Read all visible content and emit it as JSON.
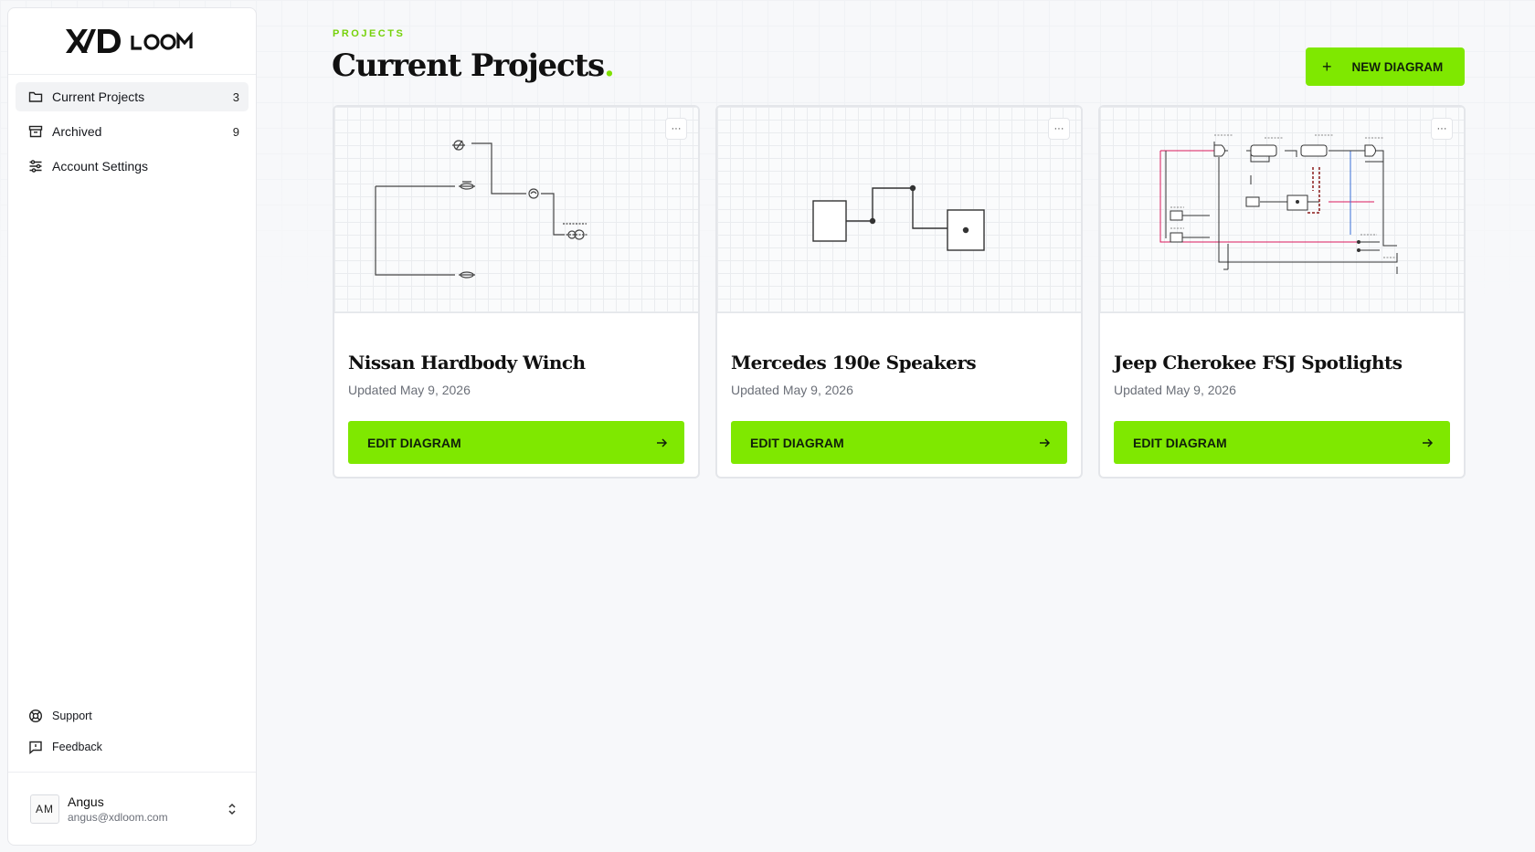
{
  "brand": {
    "logo_text": "X/D LOOM"
  },
  "sidebar": {
    "items": [
      {
        "label": "Current Projects",
        "count": "3",
        "icon": "folder-icon"
      },
      {
        "label": "Archived",
        "count": "9",
        "icon": "archive-icon"
      },
      {
        "label": "Account Settings",
        "icon": "sliders-icon"
      }
    ],
    "bottom_items": [
      {
        "label": "Support",
        "icon": "lifebuoy-icon"
      },
      {
        "label": "Feedback",
        "icon": "message-alert-icon"
      }
    ],
    "user": {
      "initials": "AM",
      "name": "Angus",
      "email": "angus@xdloom.com"
    }
  },
  "header": {
    "eyebrow": "PROJECTS",
    "title": "Current Projects",
    "title_dot": ".",
    "new_button": "NEW DIAGRAM",
    "new_icon": "+"
  },
  "projects": [
    {
      "title": "Nissan Hardbody Winch",
      "updated": "Updated May 9, 2026",
      "button": "EDIT DIAGRAM",
      "menu": "···"
    },
    {
      "title": "Mercedes 190e Speakers",
      "updated": "Updated May 9, 2026",
      "button": "EDIT DIAGRAM",
      "menu": "···"
    },
    {
      "title": "Jeep Cherokee FSJ Spotlights",
      "updated": "Updated May 9, 2026",
      "button": "EDIT DIAGRAM",
      "menu": "···"
    }
  ],
  "colors": {
    "accent": "#7fe800",
    "eyebrow": "#76d20a",
    "wire_red": "#d9195b",
    "wire_blue": "#3b6fd6"
  }
}
